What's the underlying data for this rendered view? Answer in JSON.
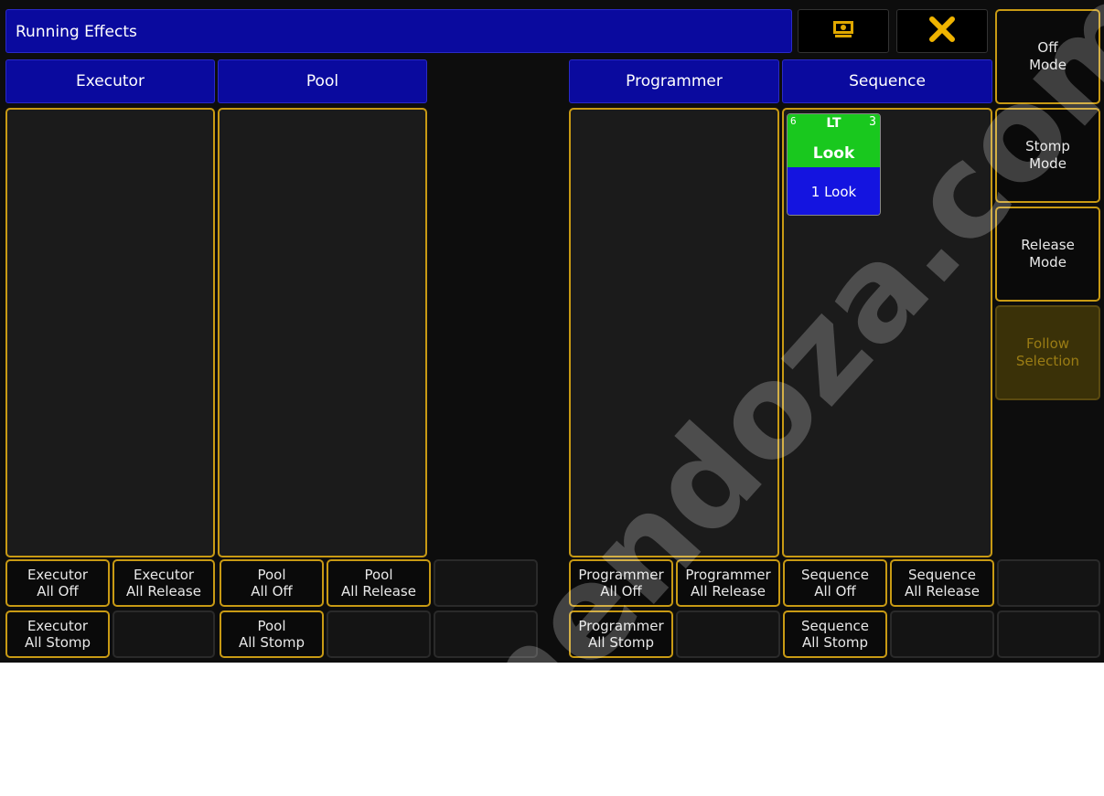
{
  "window": {
    "title": "Running Effects",
    "screen_icon": "screen-icon",
    "close_icon": "close-icon"
  },
  "columns": {
    "executor": "Executor",
    "pool": "Pool",
    "programmer": "Programmer",
    "sequence": "Sequence"
  },
  "effect_tile": {
    "left_number": "6",
    "type": "LT",
    "right_number": "3",
    "name": "Look",
    "sequence_label": "1 Look"
  },
  "side_buttons": {
    "off_mode": [
      "Off",
      "Mode"
    ],
    "stomp_mode": [
      "Stomp",
      "Mode"
    ],
    "release_mode": [
      "Release",
      "Mode"
    ],
    "follow_selection": [
      "Follow",
      "Selection"
    ]
  },
  "bottom_buttons": {
    "executor_all_off": [
      "Executor",
      "All Off"
    ],
    "executor_all_release": [
      "Executor",
      "All Release"
    ],
    "executor_all_stomp": [
      "Executor",
      "All Stomp"
    ],
    "pool_all_off": [
      "Pool",
      "All Off"
    ],
    "pool_all_release": [
      "Pool",
      "All Release"
    ],
    "pool_all_stomp": [
      "Pool",
      "All Stomp"
    ],
    "programmer_all_off": [
      "Programmer",
      "All Off"
    ],
    "programmer_all_release": [
      "Programmer",
      "All Release"
    ],
    "programmer_all_stomp": [
      "Programmer",
      "All Stomp"
    ],
    "sequence_all_off": [
      "Sequence",
      "All Off"
    ],
    "sequence_all_release": [
      "Sequence",
      "All Release"
    ],
    "sequence_all_stomp": [
      "Sequence",
      "All Stomp"
    ]
  },
  "watermark": "mendoza.com",
  "colors": {
    "accent_gold": "#c89a14",
    "header_blue": "#0a0a9e",
    "effect_green": "#19c81e",
    "effect_blue": "#1414e0"
  }
}
